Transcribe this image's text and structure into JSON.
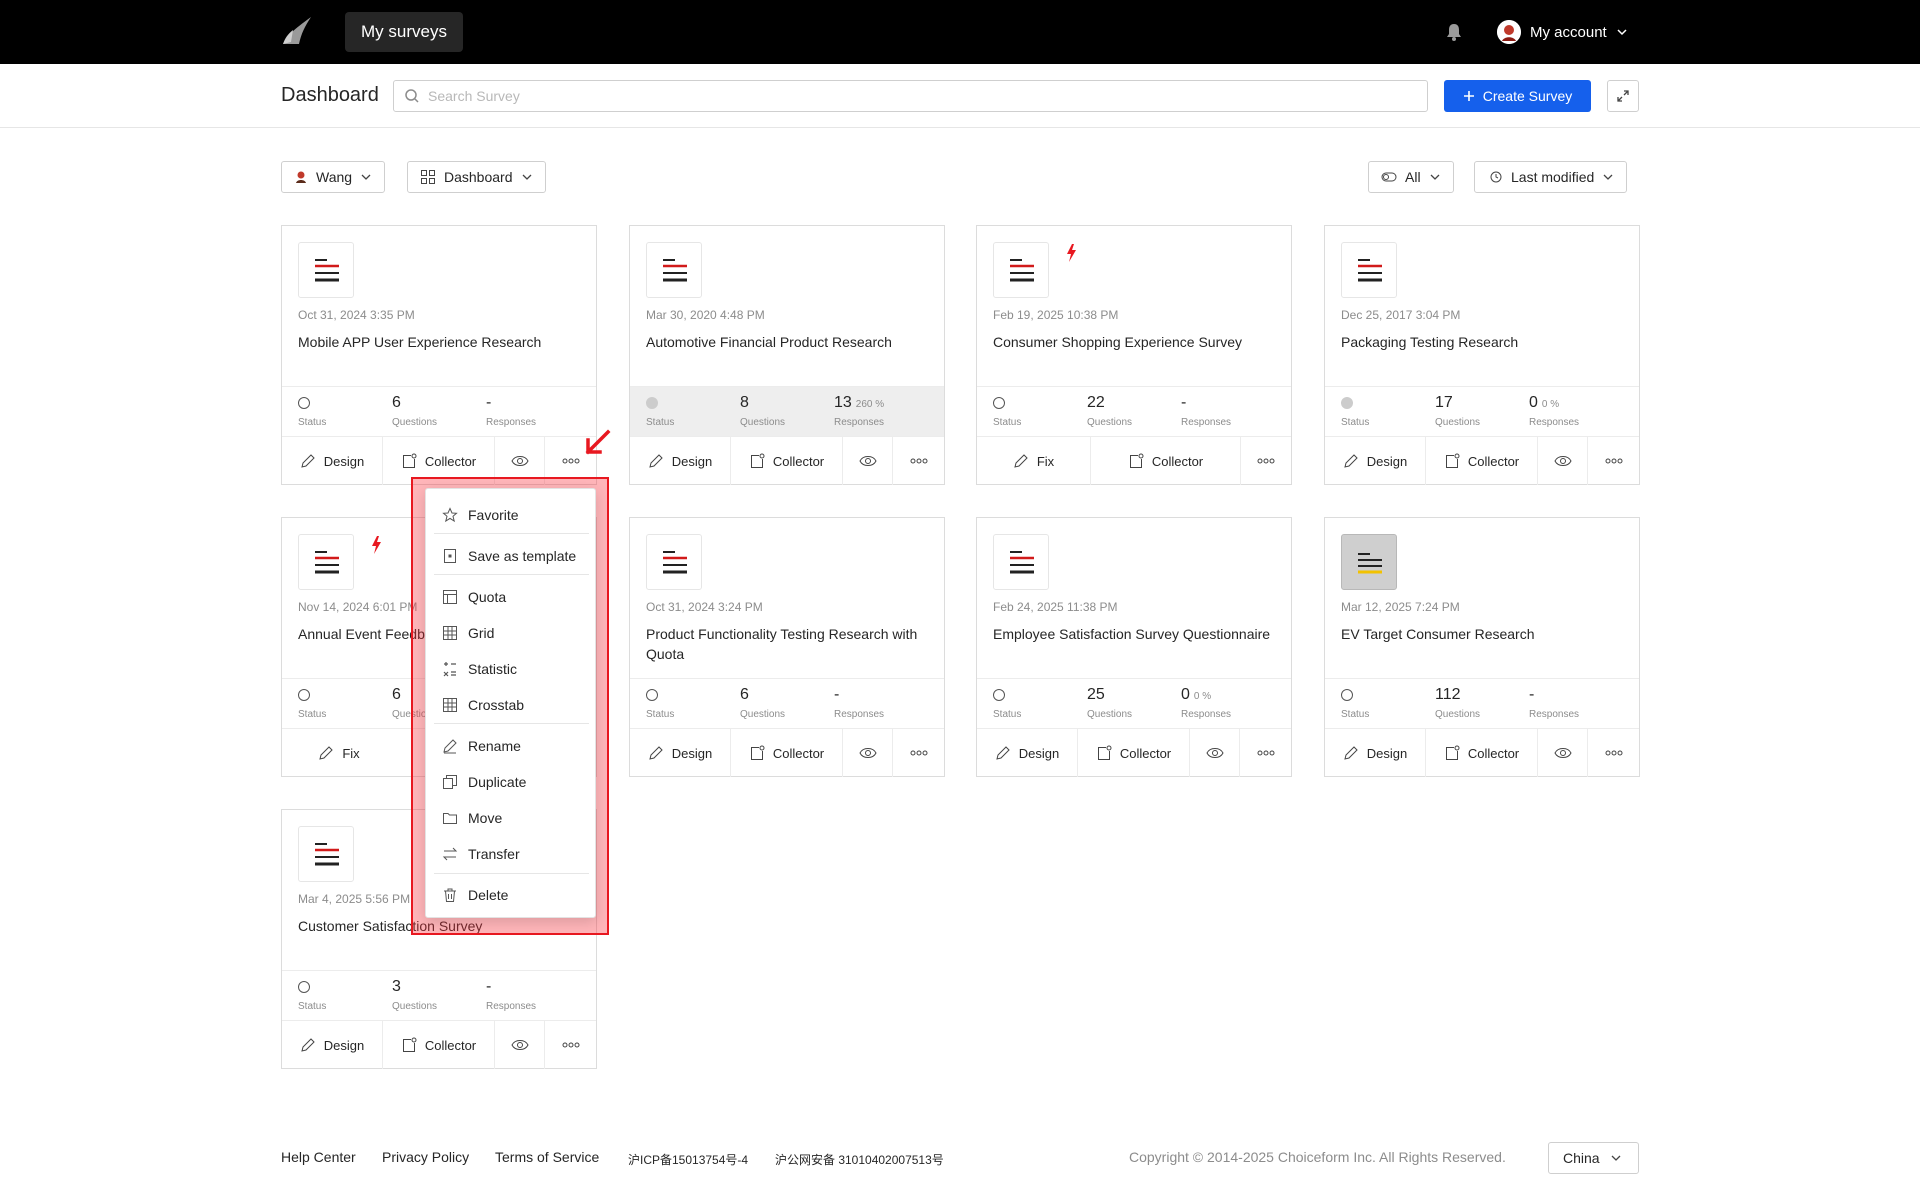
{
  "topbar": {
    "nav_label": "My surveys",
    "account_label": "My account"
  },
  "header": {
    "title": "Dashboard",
    "search_placeholder": "Search Survey",
    "create_label": "Create Survey"
  },
  "filters": {
    "owner": "Wang",
    "view": "Dashboard",
    "status": "All",
    "sort": "Last modified"
  },
  "labels": {
    "status": "Status",
    "questions": "Questions",
    "responses": "Responses",
    "design": "Design",
    "fix": "Fix",
    "collector": "Collector"
  },
  "cards": [
    {
      "date": "Oct 31, 2024 3:35 PM",
      "title": "Mobile APP User Experience Research",
      "questions": "6",
      "responses": "-",
      "responses_pct": "",
      "first_action": "Design"
    },
    {
      "date": "Mar 30, 2020 4:48 PM",
      "title": "Automotive Financial Product Research",
      "questions": "8",
      "responses": "13",
      "responses_pct": "260 %",
      "first_action": "Design"
    },
    {
      "date": "Feb 19, 2025 10:38 PM",
      "title": "Consumer Shopping Experience Survey",
      "questions": "22",
      "responses": "-",
      "responses_pct": "",
      "first_action": "Fix"
    },
    {
      "date": "Dec 25, 2017 3:04 PM",
      "title": "Packaging Testing Research",
      "questions": "17",
      "responses": "0",
      "responses_pct": "0 %",
      "first_action": "Design"
    },
    {
      "date": "Nov 14, 2024 6:01 PM",
      "title": "Annual Event Feedb",
      "questions": "6",
      "responses": "",
      "responses_pct": "",
      "first_action": "Fix"
    },
    {
      "date": "Oct 31, 2024 3:24 PM",
      "title": "Product Functionality Testing Research with Quota",
      "questions": "6",
      "responses": "-",
      "responses_pct": "",
      "first_action": "Design"
    },
    {
      "date": "Feb 24, 2025 11:38 PM",
      "title": "Employee Satisfaction Survey Questionnaire",
      "questions": "25",
      "responses": "0",
      "responses_pct": "0 %",
      "first_action": "Design"
    },
    {
      "date": "Mar 12, 2025 7:24 PM",
      "title": "EV Target Consumer Research",
      "questions": "112",
      "responses": "-",
      "responses_pct": "",
      "first_action": "Design"
    },
    {
      "date": "Mar 4, 2025 5:56 PM",
      "title": "Customer Satisfaction Survey",
      "questions": "3",
      "responses": "-",
      "responses_pct": "",
      "first_action": "Design"
    }
  ],
  "menu": {
    "items": [
      "Favorite",
      "Save as template",
      "Quota",
      "Grid",
      "Statistic",
      "Crosstab",
      "Rename",
      "Duplicate",
      "Move",
      "Transfer",
      "Delete"
    ]
  },
  "footer": {
    "help": "Help Center",
    "privacy": "Privacy Policy",
    "terms": "Terms of Service",
    "icp": "沪ICP备15013754号-4",
    "police": "沪公网安备 31010402007513号",
    "copyright": "Copyright © 2014-2025 Choiceform Inc. All Rights Reserved.",
    "country": "China"
  },
  "colors": {
    "brand": "#1560ec",
    "topbar": "#000000",
    "highlight": "#e81820"
  }
}
